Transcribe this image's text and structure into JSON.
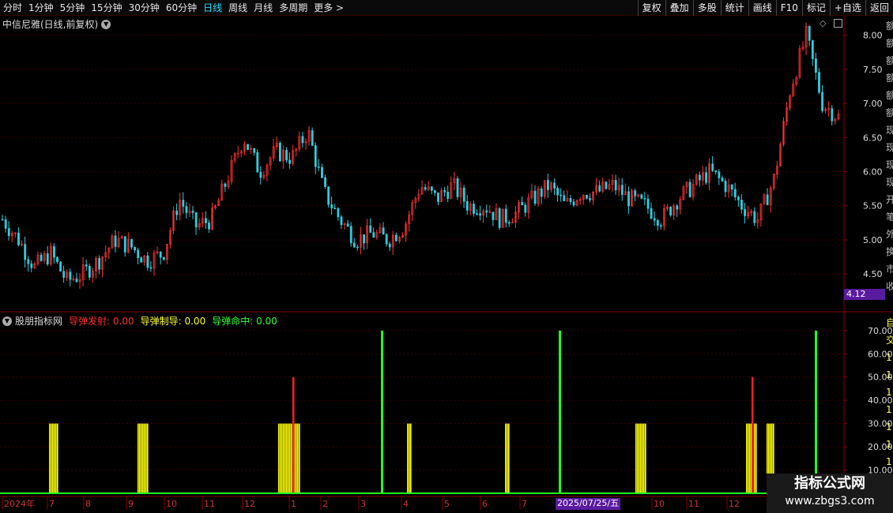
{
  "toolbar": {
    "periods": [
      "分时",
      "1分钟",
      "5分钟",
      "15分钟",
      "30分钟",
      "60分钟",
      "日线",
      "周线",
      "月线",
      "多周期",
      "更多 >"
    ],
    "active_period": "日线",
    "buttons": [
      "复权",
      "叠加",
      "多股",
      "统计",
      "画线",
      "F10",
      "标记",
      "+自选",
      "返回"
    ]
  },
  "main_panel": {
    "title": "中信尼雅(日线,前复权)",
    "price_ticks": [
      "8.00",
      "7.50",
      "7.00",
      "6.50",
      "6.00",
      "5.50",
      "5.00",
      "4.50"
    ],
    "low_marker": "4.12",
    "right_sidebar_glyphs": [
      "额",
      "额",
      "额",
      "额",
      "额",
      "额",
      "现",
      "现",
      "现",
      "现",
      "开",
      "笔",
      "外",
      "换",
      "市",
      "收"
    ]
  },
  "indicator_panel": {
    "name": "股朋指标网",
    "lines": [
      {
        "label": "导弹发射:",
        "value": "0.00",
        "color": "#ff3030"
      },
      {
        "label": "导弹制导:",
        "value": "0.00",
        "color": "#ffff33"
      },
      {
        "label": "导弹命中:",
        "value": "0.00",
        "color": "#33ff33"
      }
    ],
    "y_ticks": [
      "70.00",
      "60.00",
      "50.00",
      "40.00",
      "30.00",
      "20.00",
      "10.00"
    ],
    "right_glyphs": [
      "自",
      "交",
      "1",
      "1",
      "1",
      "1",
      "1",
      "1",
      "1"
    ]
  },
  "date_axis": {
    "labels": [
      "2024年",
      "7",
      "8",
      "9",
      "10",
      "11",
      "12",
      "1",
      "2",
      "3",
      "4",
      "5",
      "6",
      "7",
      "10",
      "11",
      "12"
    ],
    "cursor_date": "2025/07/25/五"
  },
  "watermark": {
    "title": "指标公式网",
    "url": "www.zbgs3.com"
  },
  "colors": {
    "up": "#ff3333",
    "down": "#33ccdd",
    "grid": "#3a0000",
    "launch": "#ff2020",
    "guide": "#ffff00",
    "hit": "#22ff22"
  },
  "chart_data": [
    {
      "type": "candlestick",
      "title": "中信尼雅(日线,前复权)",
      "ylim": [
        4.12,
        8.1
      ],
      "y_ticks": [
        4.5,
        5.0,
        5.5,
        6.0,
        6.5,
        7.0,
        7.5,
        8.0
      ],
      "close_path": [
        5.3,
        5.0,
        4.6,
        4.8,
        4.4,
        4.5,
        4.7,
        5.0,
        4.9,
        4.7,
        4.8,
        5.6,
        5.2,
        5.3,
        5.9,
        6.5,
        6.0,
        6.3,
        6.2,
        6.6,
        5.7,
        5.3,
        5.0,
        5.1,
        5.0,
        5.2,
        5.8,
        5.6,
        5.8,
        5.5,
        5.5,
        5.3,
        5.4,
        5.6,
        5.8,
        5.5,
        5.7,
        5.7,
        5.8,
        5.6,
        5.5,
        5.3,
        5.6,
        5.8,
        6.0,
        5.8,
        5.5,
        5.3,
        5.9,
        7.2,
        8.0,
        7.0,
        6.8
      ]
    },
    {
      "type": "bar",
      "title": "股朋指标网",
      "ylim": [
        0,
        73
      ],
      "y_ticks": [
        10,
        20,
        30,
        40,
        50,
        60,
        70
      ],
      "series": [
        {
          "name": "导弹发射",
          "values": [
            50,
            50
          ]
        },
        {
          "name": "导弹制导",
          "values": [
            30,
            30,
            30,
            30,
            30,
            30,
            30,
            30,
            30,
            30,
            30,
            30,
            30
          ]
        },
        {
          "name": "导弹命中",
          "values": [
            70,
            70,
            70
          ]
        }
      ]
    }
  ]
}
